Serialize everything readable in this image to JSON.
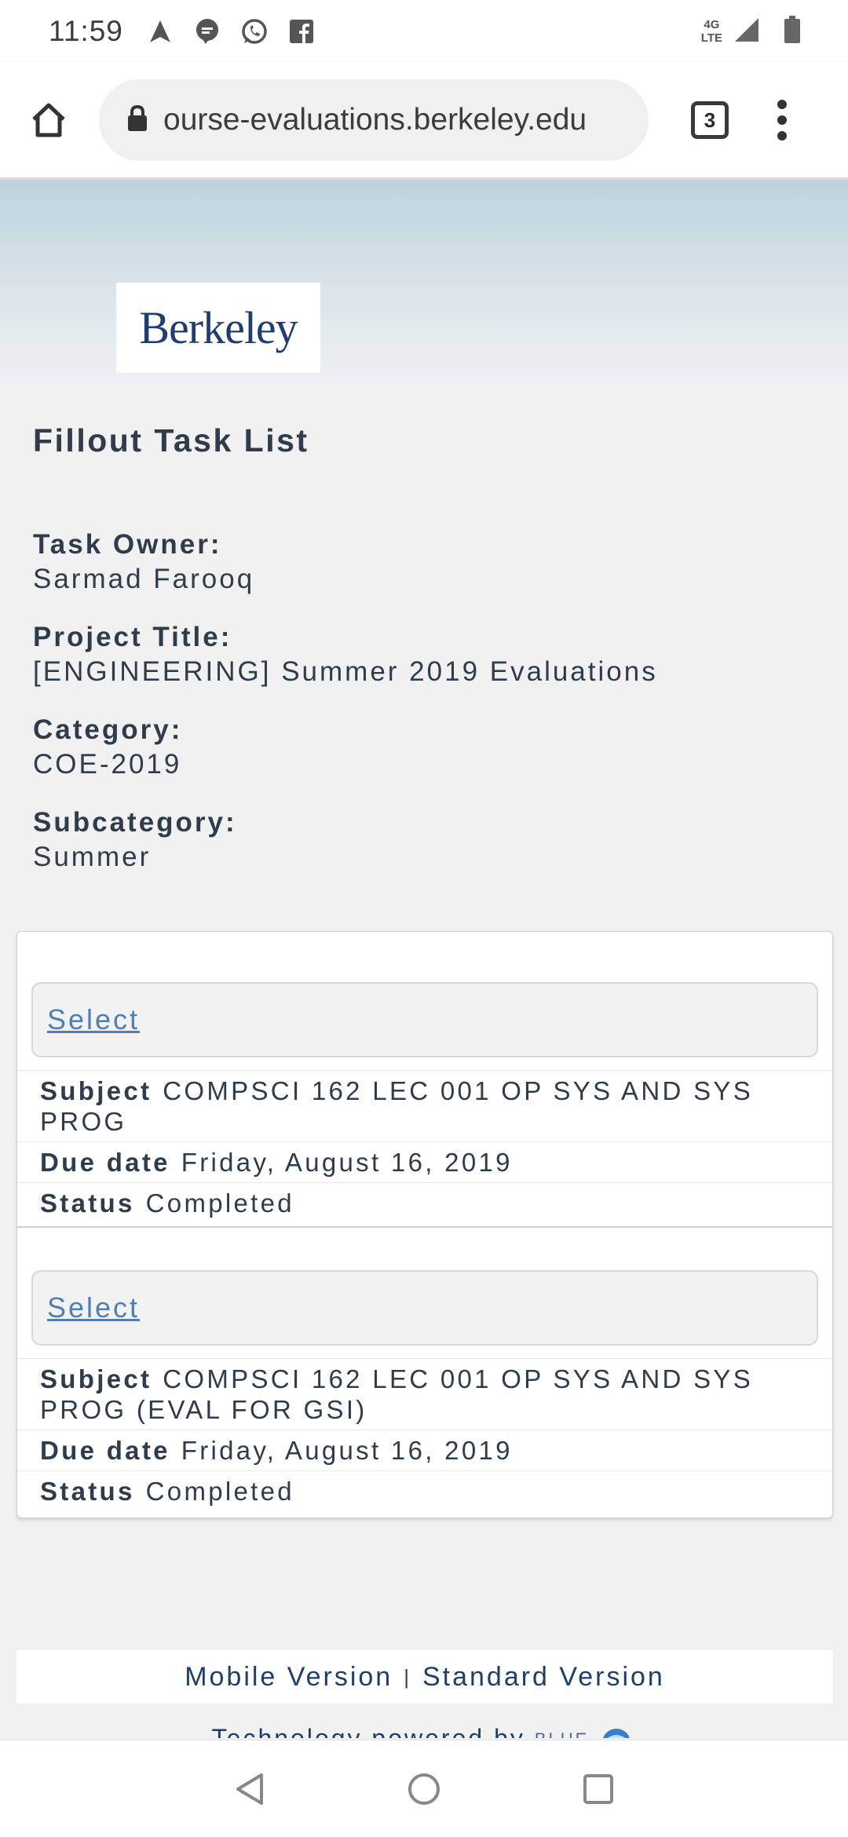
{
  "status_bar": {
    "time": "11:59",
    "network": "4G",
    "network_sub": "LTE"
  },
  "browser": {
    "url": "ourse-evaluations.berkeley.edu",
    "tab_count": "3"
  },
  "header": {
    "logo_text": "Berkeley"
  },
  "page": {
    "title": "Fillout Task List"
  },
  "info": [
    {
      "label": "Task Owner:",
      "value": "Sarmad Farooq"
    },
    {
      "label": "Project Title:",
      "value": "[ENGINEERING] Summer 2019 Evaluations"
    },
    {
      "label": "Category:",
      "value": "COE-2019"
    },
    {
      "label": "Subcategory:",
      "value": "Summer"
    }
  ],
  "tasks": [
    {
      "select_label": "Select",
      "subject_label": "Subject",
      "subject": "COMPSCI 162 LEC 001 OP SYS AND SYS PROG",
      "due_label": "Due date",
      "due": "Friday, August 16, 2019",
      "status_label": "Status",
      "status": "Completed"
    },
    {
      "select_label": "Select",
      "subject_label": "Subject",
      "subject": "COMPSCI 162 LEC 001 OP SYS AND SYS PROG (EVAL FOR GSI)",
      "due_label": "Due date",
      "due": "Friday, August 16, 2019",
      "status_label": "Status",
      "status": "Completed"
    }
  ],
  "footer": {
    "mobile_version": "Mobile Version",
    "separator": "|",
    "standard_version": "Standard Version",
    "powered_by": "Technology powered by",
    "powered_brand": "BLUE"
  },
  "icons": {
    "navigation": "navigation-arrow-icon",
    "messages": "message-icon",
    "whatsapp": "whatsapp-icon",
    "facebook": "facebook-icon",
    "signal": "signal-icon",
    "battery": "battery-icon",
    "home": "home-icon",
    "lock": "lock-icon",
    "menu": "more-vert-icon",
    "back": "back-icon",
    "home_nav": "home-circle-icon",
    "recents": "recents-icon"
  }
}
